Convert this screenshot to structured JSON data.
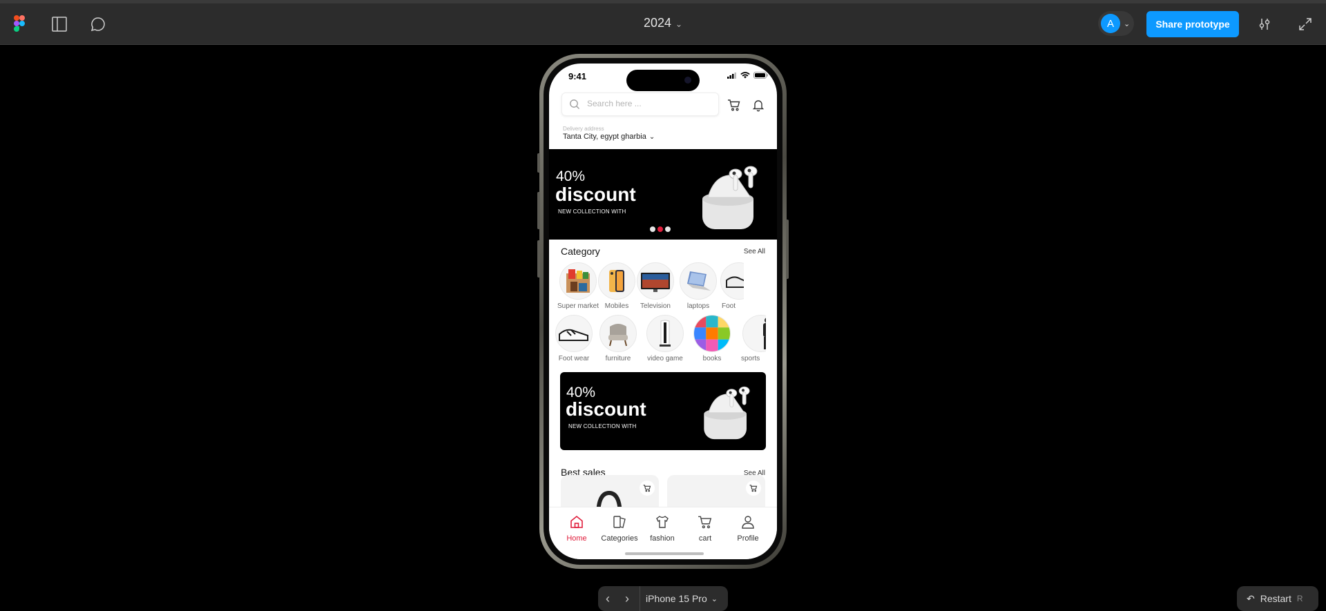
{
  "toolbar": {
    "file_title": "2024",
    "avatar_initial": "A",
    "share_label": "Share prototype"
  },
  "phone": {
    "status_time": "9:41",
    "search_placeholder": "Search here ...",
    "delivery_label": "Delivery address",
    "delivery_value": "Tanta City, egypt gharbia",
    "banner": {
      "percent": "40%",
      "headline": "discount",
      "subtitle": "NEW COLLECTION WITH",
      "carousel_total": 3,
      "carousel_active": 2
    },
    "category_title": "Category",
    "category_see_all": "See All",
    "categories_row1": [
      "Super market",
      "Mobiles",
      "Television",
      "laptops",
      "Foot"
    ],
    "categories_row2": [
      "Foot wear",
      "furniture",
      "video game",
      "books",
      "sports"
    ],
    "promo": {
      "percent": "40%",
      "headline": "discount",
      "subtitle": "NEW COLLECTION WITH"
    },
    "best_sales_title": "Best sales",
    "best_sales_see_all": "See All",
    "tabs": [
      "Home",
      "Categories",
      "fashion",
      "cart",
      "Profile"
    ],
    "active_tab": "Home"
  },
  "bottom_controls": {
    "device_label": "iPhone 15 Pro",
    "restart_label": "Restart",
    "restart_key": "R"
  },
  "colors": {
    "figma_blue": "#0d99ff",
    "accent_red": "#e01e3c",
    "toolbar_bg": "#2c2c2c"
  }
}
